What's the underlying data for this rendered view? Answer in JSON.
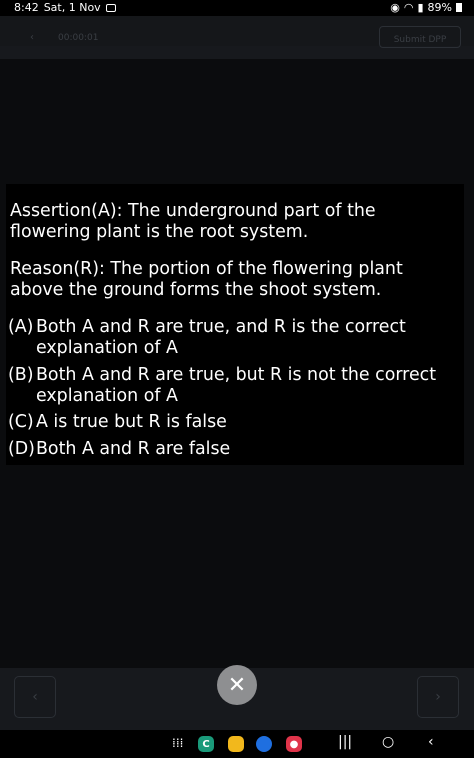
{
  "status": {
    "time": "8:42",
    "date": "Sat, 1 Nov",
    "battery": "89%"
  },
  "header": {
    "timer": "00:00:01",
    "submit_label": "Submit DPP"
  },
  "question": {
    "assertion": "Assertion(A): The underground part of the flowering plant is the root system.",
    "reason": "Reason(R): The portion of the flowering plant above the ground forms the shoot system.",
    "options": [
      {
        "letter": "(A)",
        "text": "Both A and R are true, and R is the correct explanation of A"
      },
      {
        "letter": "(B)",
        "text": "Both A and R are true, but R is not the correct explanation of A"
      },
      {
        "letter": "(C)",
        "text": "A is true but R is false"
      },
      {
        "letter": "(D)",
        "text": "Both A and R are false"
      }
    ]
  },
  "controls": {
    "prev_icon": "chevron-left-icon",
    "next_icon": "chevron-right-icon",
    "close_icon": "close-icon"
  },
  "colors": {
    "app_background": "#17191d",
    "overlay": "#0b0c0e",
    "card": "#000000",
    "close_button": "#8e8f91",
    "phone_app": "#1a9a7a",
    "notes_app": "#f2b81c",
    "messages_app": "#1f6fe0",
    "recorder_app": "#e0344a"
  }
}
